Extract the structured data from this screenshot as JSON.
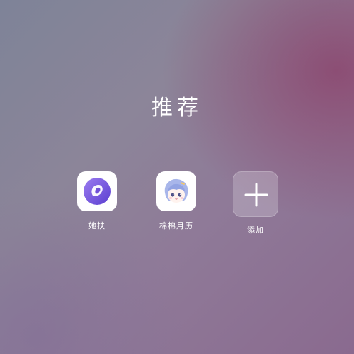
{
  "page": {
    "title": "推荐"
  },
  "apps": [
    {
      "label": "她扶",
      "icon": "purple-bird-logo-icon"
    },
    {
      "label": "棉棉月历",
      "icon": "cartoon-girl-avatar-icon"
    },
    {
      "label": "添加",
      "icon": "plus-icon"
    }
  ],
  "colors": {
    "app1_accent": "#6f4fd8",
    "app2_hair": "#a8b6ea"
  }
}
